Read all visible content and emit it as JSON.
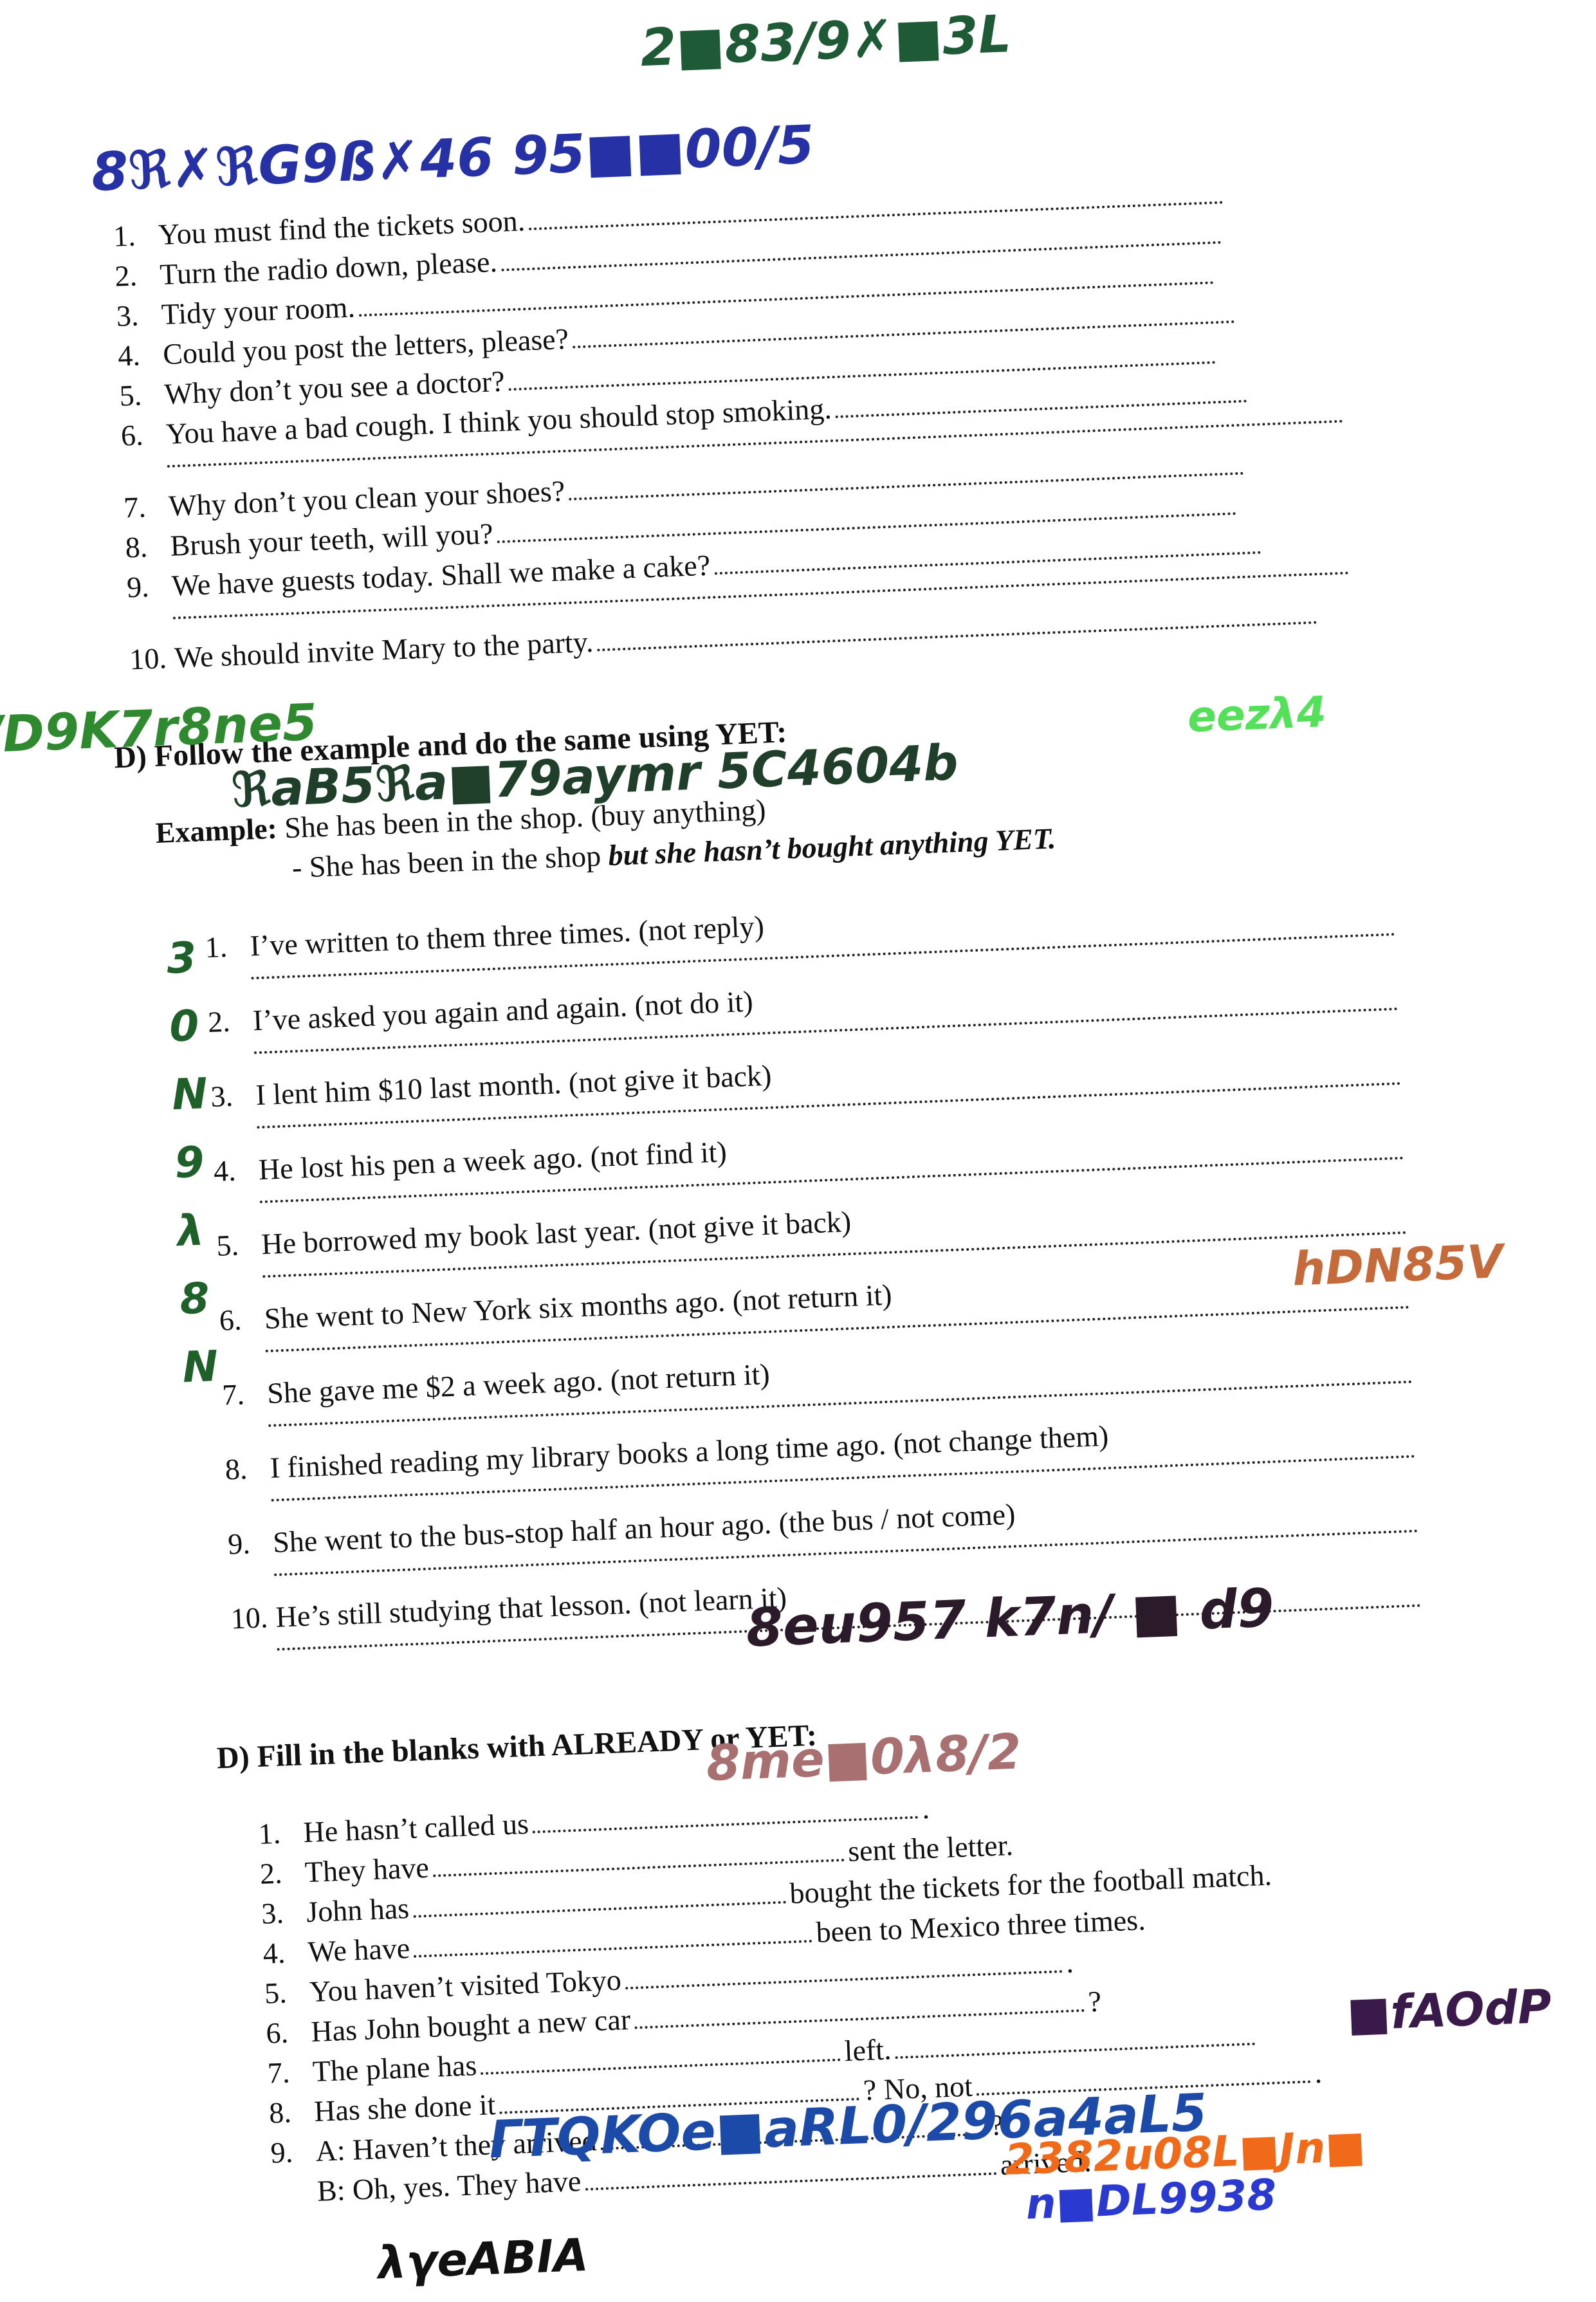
{
  "section_c": {
    "items": [
      {
        "num": "1.",
        "text": "You must find the tickets soon."
      },
      {
        "num": "2.",
        "text": "Turn the radio down, please."
      },
      {
        "num": "3.",
        "text": "Tidy your room."
      },
      {
        "num": "4.",
        "text": "Could you post the letters, please?"
      },
      {
        "num": "5.",
        "text": "Why don’t you see a doctor?"
      },
      {
        "num": "6.",
        "text": "You have a bad cough. I think you should stop smoking."
      },
      {
        "num": "7.",
        "text": "Why don’t you clean your shoes?"
      },
      {
        "num": "8.",
        "text": "Brush your teeth, will you?"
      },
      {
        "num": "9.",
        "text": "We have guests today. Shall we make a cake?"
      },
      {
        "num": "10.",
        "text": "We should invite Mary to the party."
      }
    ]
  },
  "section_d1": {
    "heading": "D) Follow the example and do the same using YET:",
    "example_label": "Example:",
    "example_text": "She has been in the shop. (buy anything)",
    "answer_prefix": "- She has been in the shop",
    "answer_emphasis": "but she hasn’t bought anything YET.",
    "items": [
      {
        "num": "1.",
        "text": "I’ve written to them three times. (not reply)"
      },
      {
        "num": "2.",
        "text": "I’ve asked you again and again. (not do it)"
      },
      {
        "num": "3.",
        "text": "I lent him $10 last month. (not give it back)"
      },
      {
        "num": "4.",
        "text": "He lost his pen a week ago. (not find it)"
      },
      {
        "num": "5.",
        "text": "He borrowed my book last year. (not give it back)"
      },
      {
        "num": "6.",
        "text": "She went to New York six months ago. (not return it)"
      },
      {
        "num": "7.",
        "text": "She gave me $2 a week ago. (not return it)"
      },
      {
        "num": "8.",
        "text": "I finished reading my library books a long time ago. (not change them)"
      },
      {
        "num": "9.",
        "text": "She went to the bus-stop half an hour ago. (the bus / not come)"
      },
      {
        "num": "10.",
        "text": "He’s still studying that lesson. (not learn it)"
      }
    ]
  },
  "section_d2": {
    "heading": "D) Fill in the blanks with ALREADY or YET:",
    "items": [
      {
        "num": "1.",
        "a": "He hasn’t called us",
        "b": ".",
        "c": ""
      },
      {
        "num": "2.",
        "a": "They have",
        "b": "sent the letter.",
        "c": ""
      },
      {
        "num": "3.",
        "a": "John has",
        "b": "bought the tickets for the football match.",
        "c": ""
      },
      {
        "num": "4.",
        "a": "We have",
        "b": "been to Mexico three times.",
        "c": ""
      },
      {
        "num": "5.",
        "a": "You haven’t visited Tokyo",
        "b": ".",
        "c": ""
      },
      {
        "num": "6.",
        "a": "Has John bought a new car",
        "b": "?",
        "c": ""
      },
      {
        "num": "7.",
        "a": "The plane has",
        "b": "left.",
        "c": ""
      },
      {
        "num": "8.",
        "a": "Has she done it",
        "b": "? No, not",
        "c": "."
      },
      {
        "num": "9.",
        "a": "A: Haven’t they arrived",
        "b": "?",
        "c": ""
      },
      {
        "num": "",
        "a": "B: Oh, yes. They have",
        "b": "arrived.",
        "c": ""
      }
    ]
  },
  "scribbles": [
    {
      "text": "2■83/9✗■3L",
      "color": "#1f5a36"
    },
    {
      "text": "8ℜ✗ℜG9ß✗46 95■■00/5",
      "color": "#2731a6"
    },
    {
      "text": "/D9K7r8ne5",
      "color": "#2f8a2f"
    },
    {
      "text": "ℜaB5ℜa■79aymr 5C4604b",
      "color": "#1f3f2a"
    },
    {
      "text": "eezλ4",
      "color": "#55e05a"
    },
    {
      "text": "3 0 N 9 λ 8 N",
      "color": "#1f5f2a"
    },
    {
      "text": "hDN85V",
      "color": "#c56a3a"
    },
    {
      "text": "8eu957 k7n/ ■ d9",
      "color": "#2a1a2a"
    },
    {
      "text": "8me■0λ8/2",
      "color": "#a87070"
    },
    {
      "text": "■fAOdP",
      "color": "#3a1a4a"
    },
    {
      "text": "ΓTQKOe■aRL0/296a4aL5",
      "color": "#1c4aa8"
    },
    {
      "text": "2382u08L■Jn■",
      "color": "#f06a1a"
    },
    {
      "text": "n■DL9938",
      "color": "#2a3ad0"
    },
    {
      "text": "λγeABIA",
      "color": "#111111"
    }
  ],
  "colors": {
    "ink": "#111111",
    "paper": "#ffffff"
  }
}
